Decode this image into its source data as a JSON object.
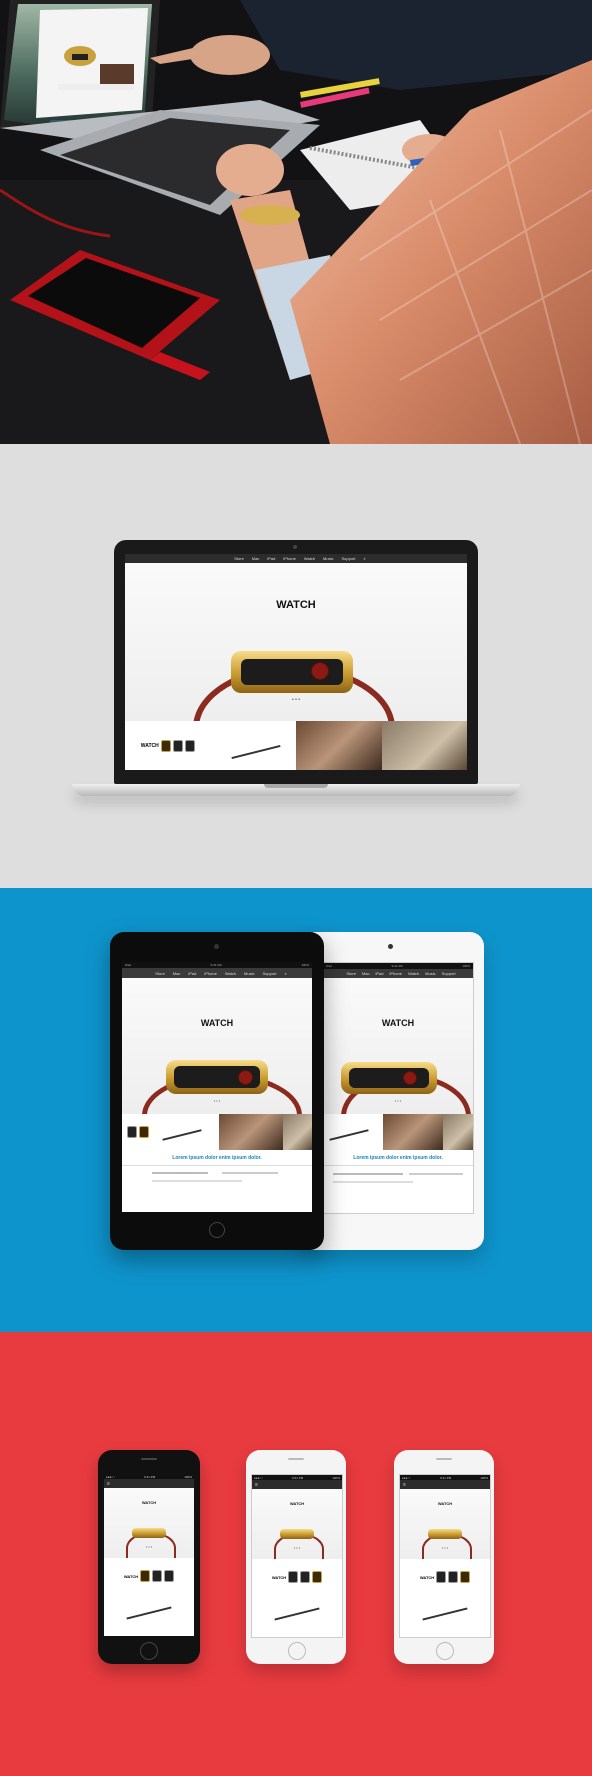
{
  "brand": {
    "logo_glyph": "",
    "watch_word": "WATCH"
  },
  "nav": {
    "items": [
      "",
      "Store",
      "Mac",
      "iPad",
      "iPhone",
      "Watch",
      "Music",
      "Support",
      "⌕"
    ]
  },
  "carousel": {
    "dots": "• • •"
  },
  "tablet": {
    "status_time": "9:41 AM",
    "status_left": "iPad",
    "status_right": "100%",
    "lorem": "Lorem ipsum dolor enim ipsum dolor."
  },
  "phone": {
    "status_time": "9:41 PM",
    "status_left": "●●●○○",
    "status_right": "100%",
    "menu_icon": "≡"
  },
  "colors": {
    "panel_gray": "#dedede",
    "panel_blue": "#0e94cc",
    "panel_red": "#e83b3f",
    "band_red": "#8b2a1e",
    "link_blue": "#1a80c4"
  }
}
